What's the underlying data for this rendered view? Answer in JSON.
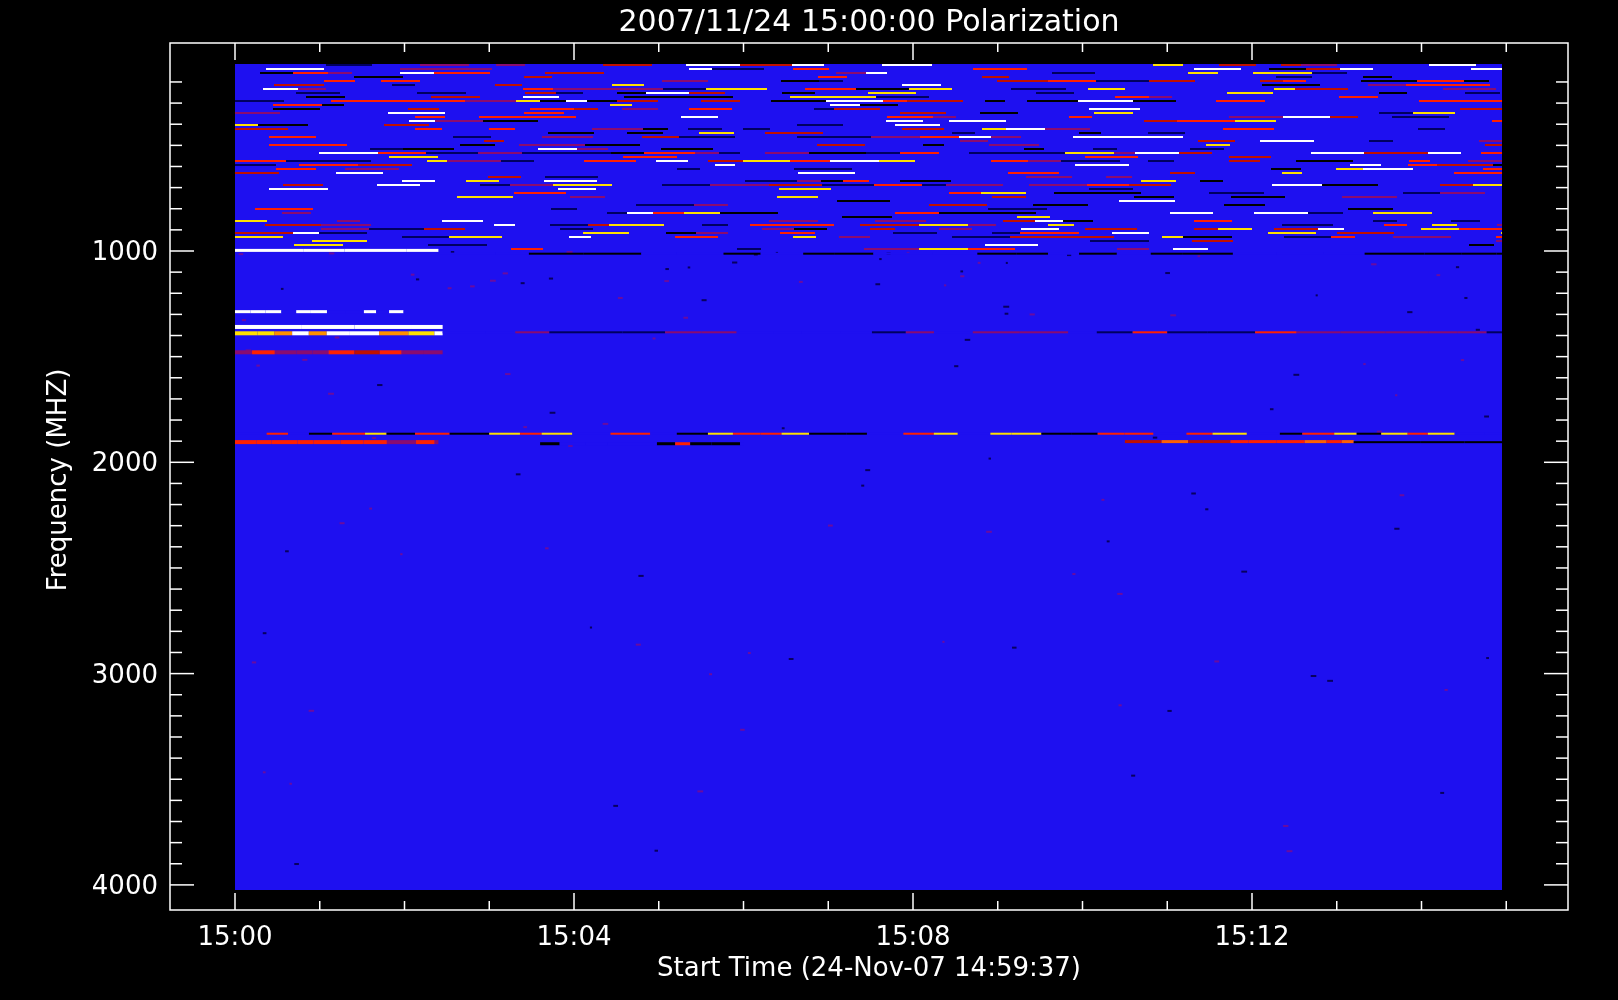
{
  "title": "2007/11/24 15:00:00 Polarization",
  "y_axis": {
    "label": "Frequency (MHZ)",
    "ticks": [
      "1000",
      "2000",
      "3000",
      "4000"
    ]
  },
  "x_axis": {
    "label": "Start Time (24-Nov-07 14:59:37)",
    "ticks": [
      "15:00",
      "15:04",
      "15:08",
      "15:12"
    ]
  }
}
